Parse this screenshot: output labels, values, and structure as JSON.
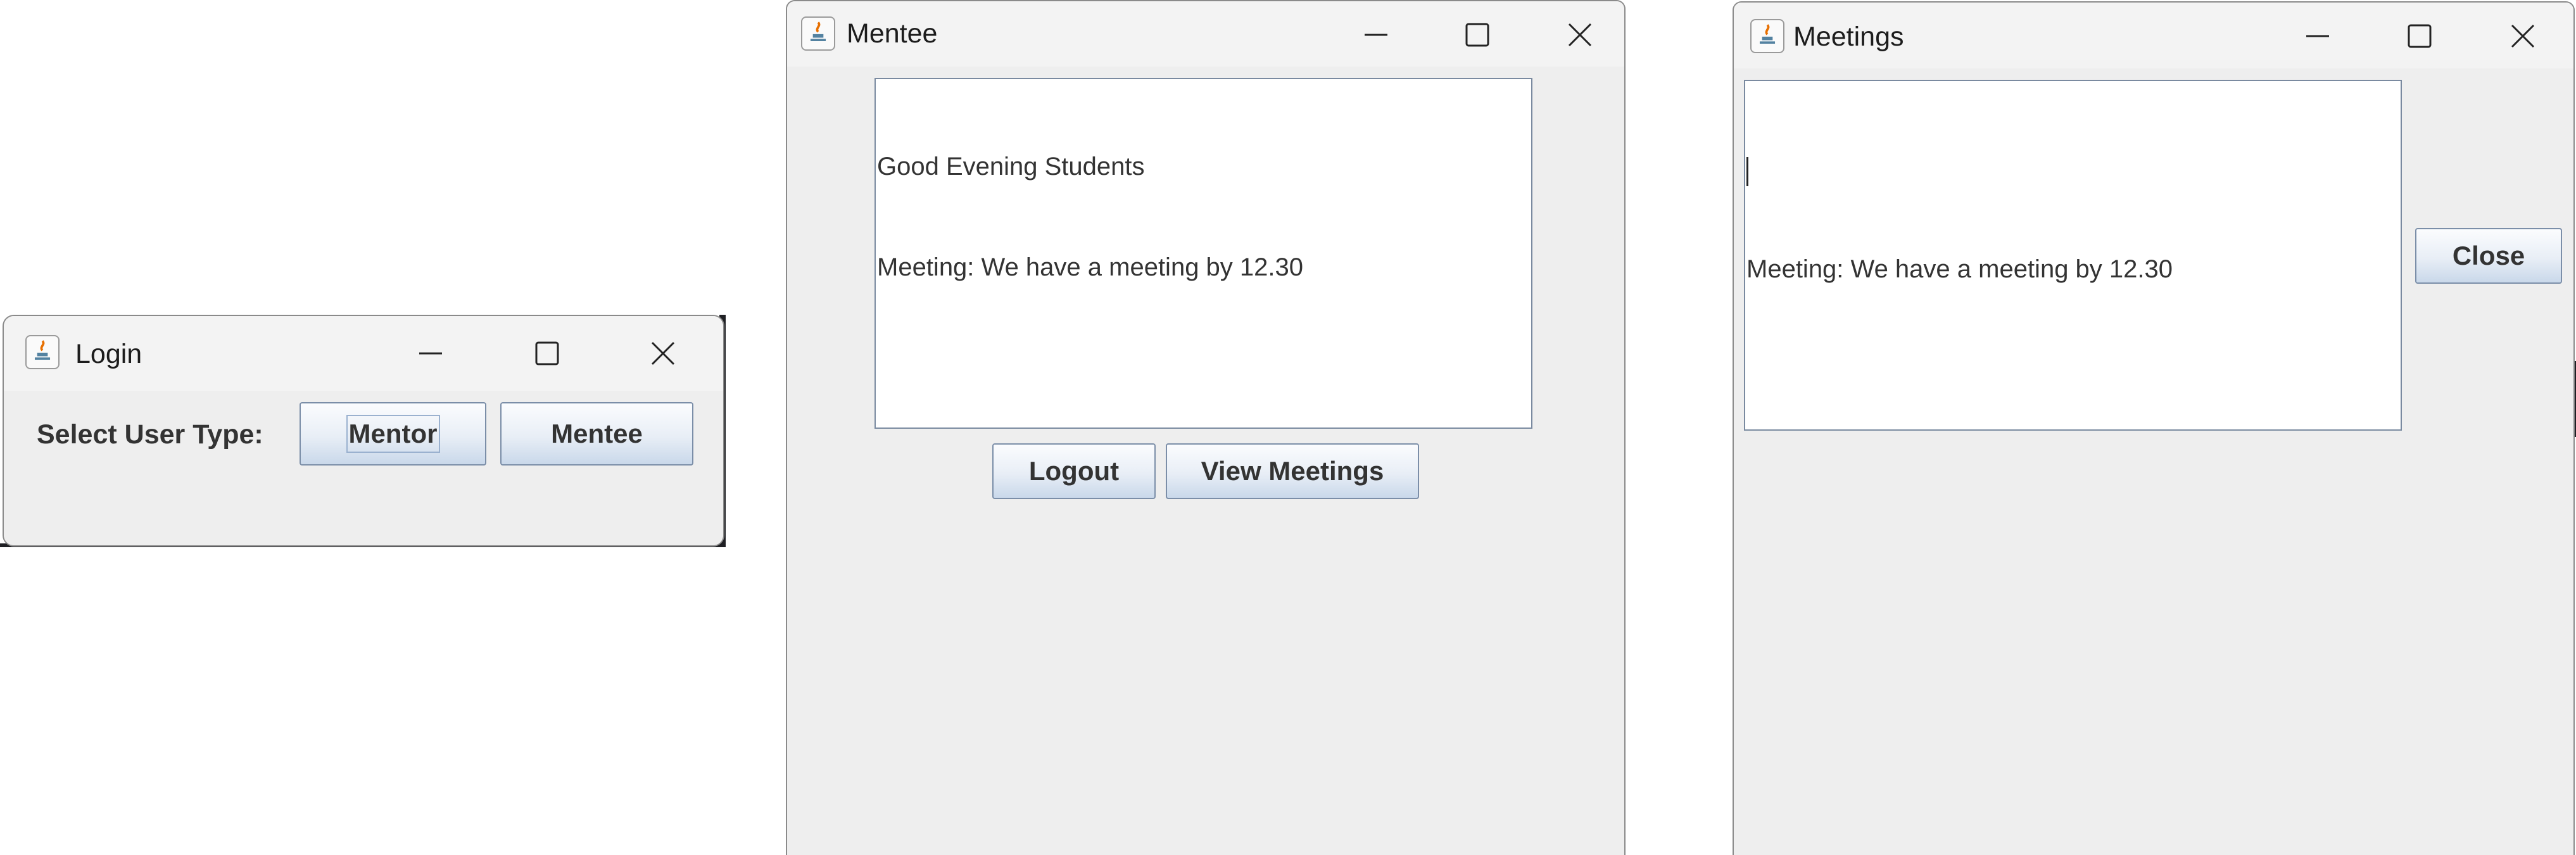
{
  "login_window": {
    "title": "Login",
    "select_label": "Select User Type:",
    "mentor_button": "Mentor",
    "mentee_button": "Mentee"
  },
  "mentee_window": {
    "title": "Mentee",
    "messages": [
      "Good Evening Students",
      "Meeting: We have a meeting by 12.30"
    ],
    "logout_button": "Logout",
    "view_meetings_button": "View Meetings"
  },
  "meetings_window": {
    "title": "Meetings",
    "lines": [
      "",
      "Meeting: We have a meeting by 12.30"
    ],
    "close_button": "Close"
  },
  "window_controls": [
    "minimize-icon",
    "maximize-icon",
    "close-icon"
  ],
  "colors": {
    "window_bg": "#eeeeee",
    "titlebar_bg": "#f3f3f3",
    "button_border": "#7b8ea8",
    "text": "#333333"
  }
}
